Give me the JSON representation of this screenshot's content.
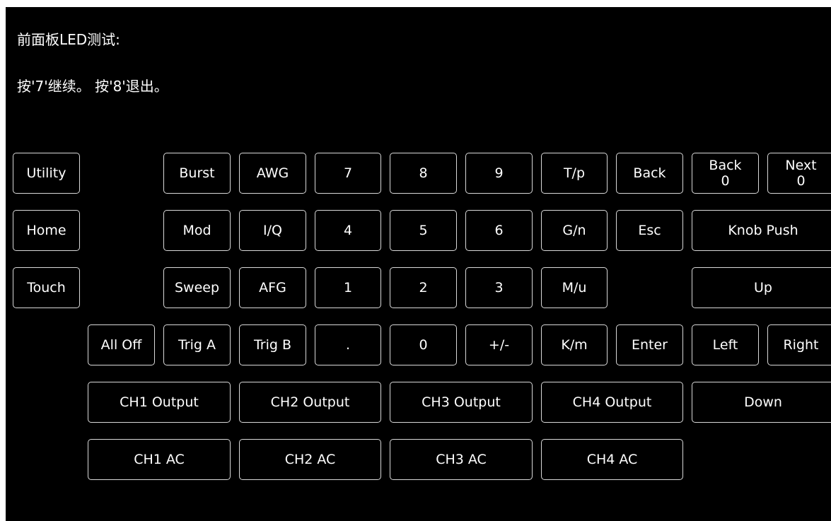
{
  "header": {
    "line1": "前面板LED测试:",
    "line2": "按'7'继续。 按'8'退出。"
  },
  "keys": {
    "utility": "Utility",
    "home": "Home",
    "touch": "Touch",
    "burst": "Burst",
    "awg": "AWG",
    "n7": "7",
    "n8": "8",
    "n9": "9",
    "tp": "T/p",
    "back": "Back",
    "back_counter": {
      "label": "Back",
      "value": "0"
    },
    "next_counter": {
      "label": "Next",
      "value": "0"
    },
    "mod": "Mod",
    "iq": "I/Q",
    "n4": "4",
    "n5": "5",
    "n6": "6",
    "gn": "G/n",
    "esc": "Esc",
    "knob_push": "Knob Push",
    "sweep": "Sweep",
    "afg": "AFG",
    "n1": "1",
    "n2": "2",
    "n3": "3",
    "mu": "M/u",
    "up": "Up",
    "all_off": "All Off",
    "trig_a": "Trig A",
    "trig_b": "Trig B",
    "dot": ".",
    "n0": "0",
    "plus_minus": "+/-",
    "km": "K/m",
    "enter": "Enter",
    "left": "Left",
    "right": "Right",
    "ch1_output": "CH1 Output",
    "ch2_output": "CH2 Output",
    "ch3_output": "CH3 Output",
    "ch4_output": "CH4 Output",
    "down": "Down",
    "ch1_ac": "CH1 AC",
    "ch2_ac": "CH2 AC",
    "ch3_ac": "CH3 AC",
    "ch4_ac": "CH4 AC"
  },
  "colors": {
    "background": "#000000",
    "text": "#ffffff",
    "border": "#d9d9d9"
  }
}
